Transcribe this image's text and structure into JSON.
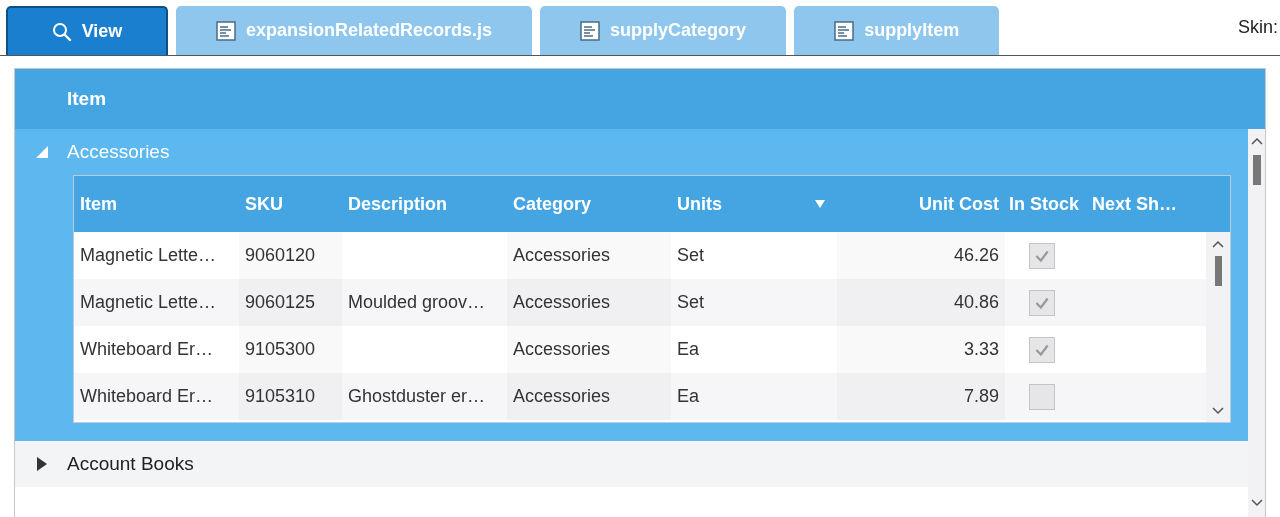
{
  "tabs": [
    {
      "label": "View",
      "kind": "view",
      "selected": true
    },
    {
      "label": "expansionRelatedRecords.js",
      "kind": "document",
      "selected": false
    },
    {
      "label": "supplyCategory",
      "kind": "document",
      "selected": false
    },
    {
      "label": "supplyItem",
      "kind": "document",
      "selected": false
    }
  ],
  "skin_label": "Skin:",
  "grid": {
    "header": "Item",
    "groups": [
      {
        "label": "Accessories",
        "expanded": true,
        "table": {
          "columns": [
            {
              "label": "Item",
              "kind": "item",
              "sorted": false
            },
            {
              "label": "SKU",
              "kind": "sku",
              "sorted": false
            },
            {
              "label": "Description",
              "kind": "description",
              "sorted": false
            },
            {
              "label": "Category",
              "kind": "category",
              "sorted": false
            },
            {
              "label": "Units",
              "kind": "units",
              "sorted": true
            },
            {
              "label": "Unit Cost",
              "kind": "unit_cost",
              "sorted": false
            },
            {
              "label": "In Stock",
              "kind": "in_stock",
              "sorted": false
            },
            {
              "label": "Next Sh…",
              "kind": "next_ship",
              "sorted": false
            }
          ],
          "rows": [
            {
              "item": "Magnetic Lette…",
              "sku": "9060120",
              "category": "Accessories",
              "units": "Set",
              "unit_cost": "46.26",
              "in_stock": true
            },
            {
              "item": "Magnetic Lette…",
              "sku": "9060125",
              "description": "Moulded groov…",
              "category": "Accessories",
              "units": "Set",
              "unit_cost": "40.86",
              "in_stock": true
            },
            {
              "item": "Whiteboard Er…",
              "sku": "9105300",
              "category": "Accessories",
              "units": "Ea",
              "unit_cost": "3.33",
              "in_stock": true
            },
            {
              "item": "Whiteboard Er…",
              "sku": "9105310",
              "description": "Ghostduster er…",
              "category": "Accessories",
              "units": "Ea",
              "unit_cost": "7.89",
              "in_stock": false
            }
          ]
        }
      },
      {
        "label": "Account Books",
        "expanded": false
      }
    ]
  }
}
